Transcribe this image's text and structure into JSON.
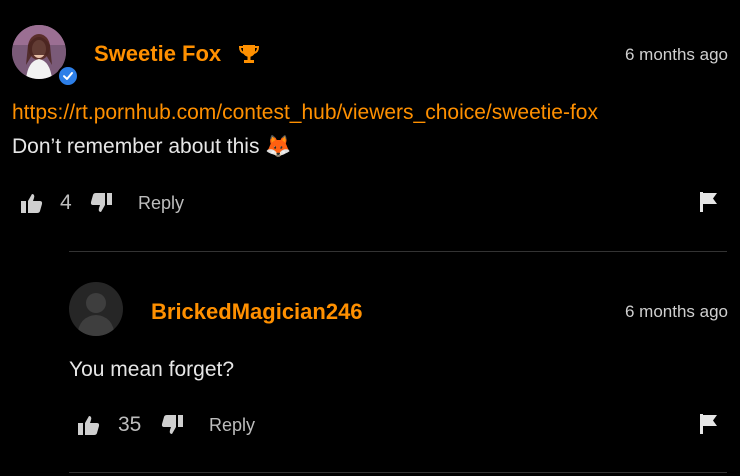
{
  "comments": [
    {
      "username": "Sweetie Fox",
      "timestamp": "6 months ago",
      "link": "https://rt.pornhub.com/contest_hub/viewers_choice/sweetie-fox",
      "text": "Don’t remember about this",
      "emoji": "🦊",
      "likes": "4",
      "reply_label": "Reply",
      "badge_icon": "trophy-icon",
      "verified": true
    },
    {
      "username": "BrickedMagician246",
      "timestamp": "6 months ago",
      "text": "You mean forget?",
      "likes": "35",
      "reply_label": "Reply"
    }
  ],
  "colors": {
    "accent": "#ff9000",
    "background": "#000000",
    "verified": "#2d7fe8"
  }
}
